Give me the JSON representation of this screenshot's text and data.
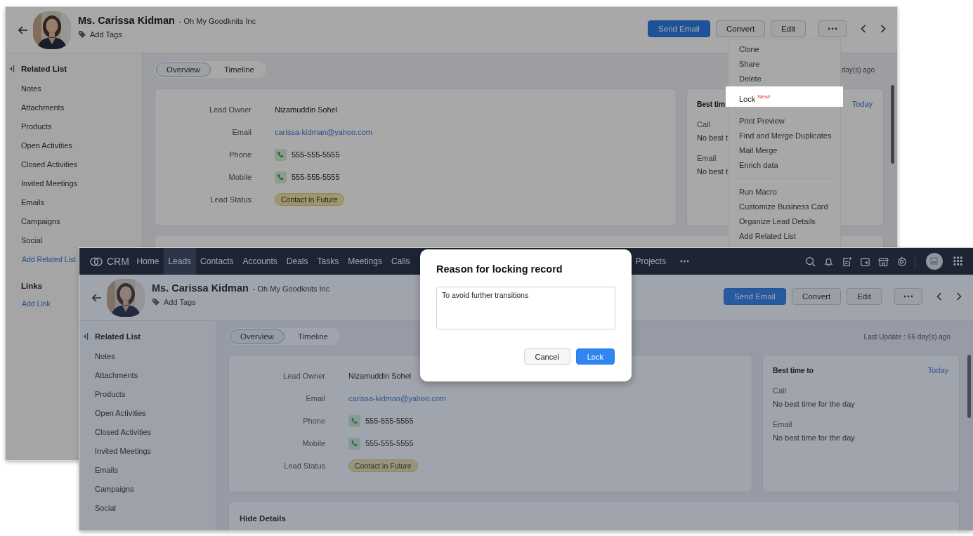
{
  "back_window": {
    "record": {
      "name": "Ms. Carissa Kidman",
      "company": "- Oh My Goodknits Inc",
      "add_tags": "Add Tags"
    },
    "actions": [
      {
        "label": "Send Email",
        "primary": true
      },
      {
        "label": "Convert",
        "primary": false
      },
      {
        "label": "Edit",
        "primary": false
      }
    ],
    "sidebar": {
      "title": "Related List",
      "items": [
        "Notes",
        "Attachments",
        "Products",
        "Open Activities",
        "Closed Activities",
        "Invited Meetings",
        "Emails",
        "Campaigns",
        "Social"
      ],
      "add_related": "Add Related List",
      "links_title": "Links",
      "add_link": "Add Link"
    },
    "tabs": [
      {
        "label": "Overview",
        "selected": true
      },
      {
        "label": "Timeline",
        "selected": false
      }
    ],
    "last_update": "day(s) ago",
    "fields": [
      {
        "label": "Lead Owner",
        "value": "Nizamuddin Sohel",
        "kind": "text"
      },
      {
        "label": "Email",
        "value": "carissa-kidman@yahoo.com",
        "kind": "link"
      },
      {
        "label": "Phone",
        "value": "555-555-5555",
        "kind": "phone"
      },
      {
        "label": "Mobile",
        "value": "555-555-5555",
        "kind": "phone"
      },
      {
        "label": "Lead Status",
        "value": "Contact in Future",
        "kind": "status"
      }
    ],
    "best_time": {
      "title": "Best tim",
      "today": "Today",
      "items": [
        {
          "label": "Call",
          "value": "No best t"
        },
        {
          "label": "Email",
          "value": "No best t"
        }
      ]
    },
    "menu": [
      [
        {
          "label": "Clone",
          "highlighted": false
        },
        {
          "label": "Share",
          "highlighted": false
        },
        {
          "label": "Delete",
          "highlighted": false
        },
        {
          "label": "Lock",
          "badge": "New!",
          "highlighted": true
        }
      ],
      [
        {
          "label": "Print Preview",
          "highlighted": false
        },
        {
          "label": "Find and Merge Duplicates",
          "highlighted": false
        },
        {
          "label": "Mail Merge",
          "highlighted": false
        },
        {
          "label": "Enrich data",
          "highlighted": false
        }
      ],
      [
        {
          "label": "Run Macro",
          "highlighted": false
        },
        {
          "label": "Customize Business Card",
          "highlighted": false
        },
        {
          "label": "Organize Lead Details",
          "highlighted": false
        },
        {
          "label": "Add Related List",
          "highlighted": false
        }
      ]
    ]
  },
  "front_window": {
    "nav": {
      "logo": "CRM",
      "items": [
        {
          "label": "Home",
          "selected": false
        },
        {
          "label": "Leads",
          "selected": true
        },
        {
          "label": "Contacts",
          "selected": false
        },
        {
          "label": "Accounts",
          "selected": false
        },
        {
          "label": "Deals",
          "selected": false
        },
        {
          "label": "Tasks",
          "selected": false
        },
        {
          "label": "Meetings",
          "selected": false
        },
        {
          "label": "Calls",
          "selected": false
        }
      ],
      "more_items": [
        {
          "label": "Projects",
          "selected": false
        }
      ]
    },
    "record": {
      "name": "Ms. Carissa Kidman",
      "company": "- Oh My Goodknits Inc",
      "add_tags": "Add Tags"
    },
    "actions": [
      {
        "label": "Send Email",
        "primary": true
      },
      {
        "label": "Convert",
        "primary": false
      },
      {
        "label": "Edit",
        "primary": false
      }
    ],
    "sidebar": {
      "title": "Related List",
      "items": [
        "Notes",
        "Attachments",
        "Products",
        "Open Activities",
        "Closed Activities",
        "Invited Meetings",
        "Emails",
        "Campaigns",
        "Social"
      ]
    },
    "tabs": [
      {
        "label": "Overview",
        "selected": true
      },
      {
        "label": "Timeline",
        "selected": false
      }
    ],
    "last_update": "Last Update : 66 day(s) ago",
    "fields": [
      {
        "label": "Lead Owner",
        "value": "Nizamuddin Sohel",
        "kind": "text"
      },
      {
        "label": "Email",
        "value": "carissa-kidman@yahoo.com",
        "kind": "link"
      },
      {
        "label": "Phone",
        "value": "555-555-5555",
        "kind": "phone"
      },
      {
        "label": "Mobile",
        "value": "555-555-5555",
        "kind": "phone"
      },
      {
        "label": "Lead Status",
        "value": "Contact in Future",
        "kind": "status"
      }
    ],
    "best_time": {
      "title": "Best time to",
      "today": "Today",
      "items": [
        {
          "label": "Call",
          "value": "No best time for the day"
        },
        {
          "label": "Email",
          "value": "No best time for the day"
        }
      ]
    },
    "hide_details": "Hide Details",
    "dialog": {
      "title": "Reason for locking record",
      "reason": "To avoid further transitions",
      "buttons": [
        {
          "label": "Cancel",
          "primary": false
        },
        {
          "label": "Lock",
          "primary": true
        }
      ]
    }
  }
}
